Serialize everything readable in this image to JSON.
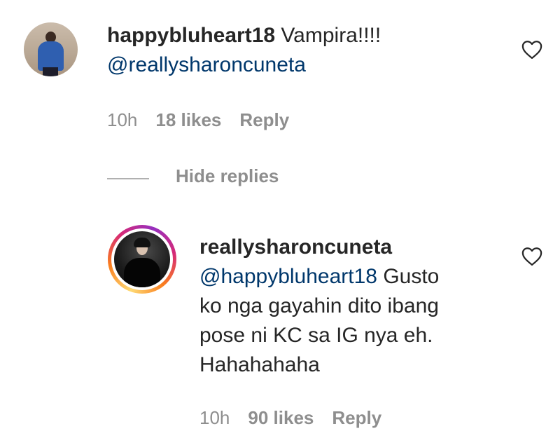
{
  "comments": [
    {
      "username": "happybluheart18",
      "text": " Vampira!!!!",
      "mention": "@reallysharoncuneta",
      "time": "10h",
      "likes": "18 likes",
      "reply_label": "Reply",
      "like_icon": "heart-outline-icon"
    }
  ],
  "hide_replies": {
    "label": "Hide replies"
  },
  "replies": [
    {
      "username": "reallysharoncuneta",
      "mention": "@happybluheart18",
      "text_line1": " Gusto",
      "text_line2": "ko nga gayahin dito ibang",
      "text_line3": "pose ni KC sa IG nya eh.",
      "text_line4": "Hahahahaha",
      "time": "10h",
      "likes": "90 likes",
      "reply_label": "Reply",
      "like_icon": "heart-outline-icon",
      "story_ring_colors": [
        "#feda75",
        "#fa7e1e",
        "#d62976",
        "#962fbf"
      ]
    }
  ]
}
